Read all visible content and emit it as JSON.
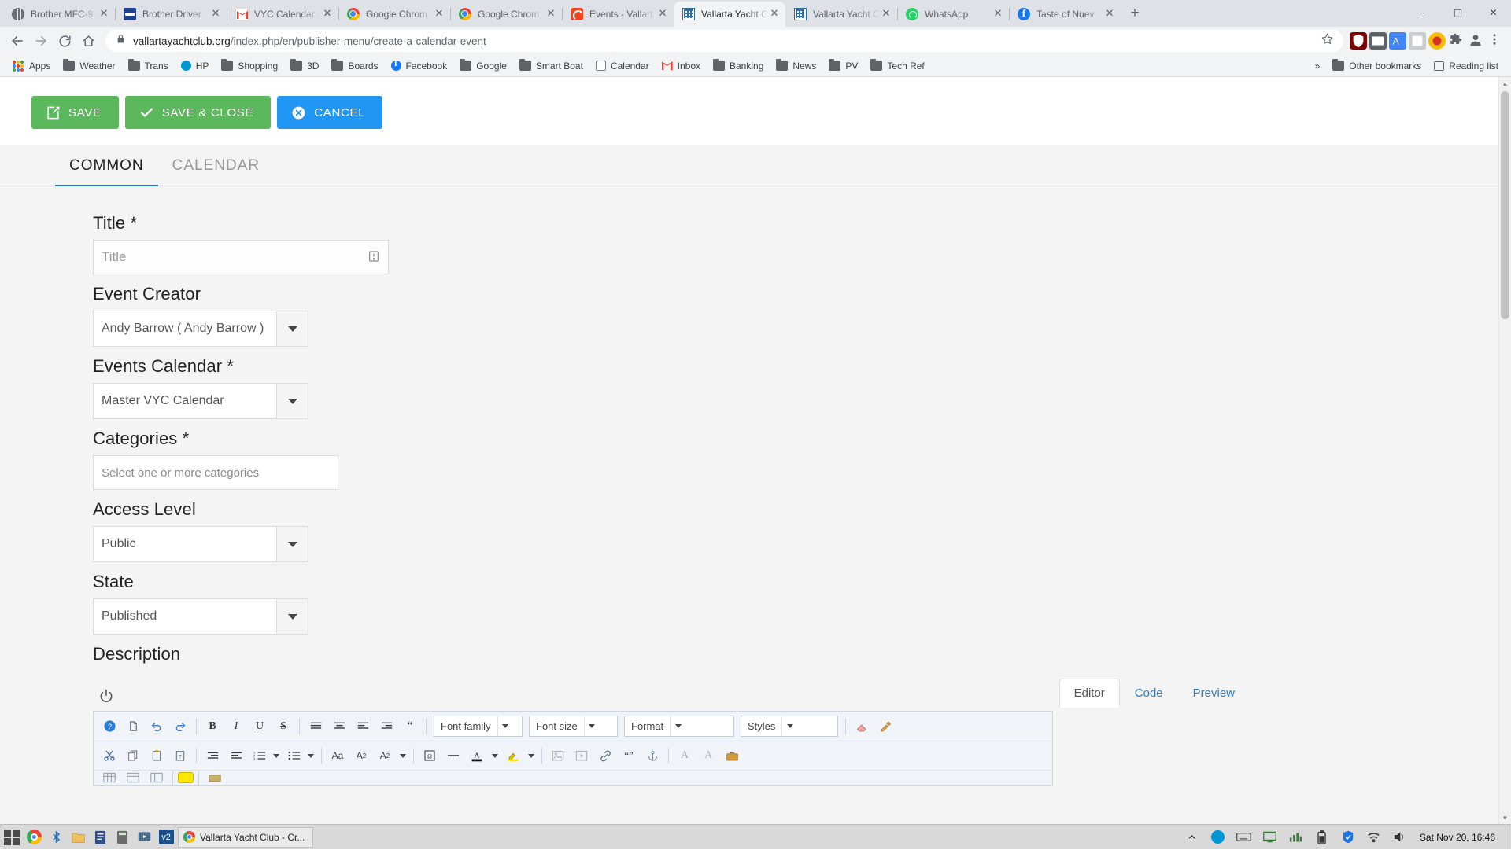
{
  "browser": {
    "tabs": [
      {
        "title": "Brother MFC-9...",
        "favicon": "globe-icon",
        "active": false
      },
      {
        "title": "Brother Driver",
        "favicon": "brother-icon",
        "active": false
      },
      {
        "title": "VYC Calendar -",
        "favicon": "gmail-icon",
        "active": false
      },
      {
        "title": "Google Chrom",
        "favicon": "chrome-icon",
        "active": false
      },
      {
        "title": "Google Chrom",
        "favicon": "chrome-icon",
        "active": false
      },
      {
        "title": "Events - Vallart",
        "favicon": "joomla-icon",
        "active": false
      },
      {
        "title": "Vallarta Yacht C",
        "favicon": "grid-icon",
        "active": true
      },
      {
        "title": "Vallarta Yacht C",
        "favicon": "grid-icon",
        "active": false
      },
      {
        "title": "WhatsApp",
        "favicon": "whatsapp-icon",
        "active": false
      },
      {
        "title": "Taste of Nuev",
        "favicon": "facebook-icon",
        "active": false
      }
    ],
    "new_tab_label": "+",
    "window_controls": [
      "–",
      "□",
      "✕"
    ],
    "omnibox": {
      "url_domain": "vallartayachtclub.org",
      "url_path": "/index.php/en/publisher-menu/create-a-calendar-event",
      "lock_icon": "lock-icon",
      "star_icon": "bookmark-star-icon"
    },
    "bookmarks": [
      {
        "label": "Apps",
        "icon": "apps-grid-icon"
      },
      {
        "label": "Weather",
        "icon": "folder-icon"
      },
      {
        "label": "Trans",
        "icon": "folder-icon"
      },
      {
        "label": "HP",
        "icon": "hp-icon"
      },
      {
        "label": "Shopping",
        "icon": "folder-icon"
      },
      {
        "label": "3D",
        "icon": "folder-icon"
      },
      {
        "label": "Boards",
        "icon": "folder-icon"
      },
      {
        "label": "Facebook",
        "icon": "facebook-icon"
      },
      {
        "label": "Google",
        "icon": "folder-icon"
      },
      {
        "label": "Smart Boat",
        "icon": "folder-icon"
      },
      {
        "label": "Calendar",
        "icon": "calendar-icon"
      },
      {
        "label": "Inbox",
        "icon": "gmail-icon"
      },
      {
        "label": "Banking",
        "icon": "folder-icon"
      },
      {
        "label": "News",
        "icon": "folder-icon"
      },
      {
        "label": "PV",
        "icon": "folder-icon"
      },
      {
        "label": "Tech Ref",
        "icon": "folder-icon"
      }
    ],
    "bookmarks_overflow": "»",
    "other_bookmarks": "Other bookmarks",
    "reading_list": "Reading list"
  },
  "page": {
    "toolbar": [
      {
        "label": "SAVE",
        "icon": "save-pencil-icon",
        "style": "green"
      },
      {
        "label": "SAVE & CLOSE",
        "icon": "check-icon",
        "style": "green"
      },
      {
        "label": "CANCEL",
        "icon": "circle-x-icon",
        "style": "blue"
      }
    ],
    "tabs": [
      {
        "label": "COMMON",
        "active": true
      },
      {
        "label": "CALENDAR",
        "active": false
      }
    ],
    "fields": {
      "title": {
        "label": "Title *",
        "placeholder": "Title",
        "value": "",
        "icon": "calendar-input-icon"
      },
      "event_creator": {
        "label": "Event Creator",
        "value": "Andy Barrow ( Andy Barrow )"
      },
      "events_calendar": {
        "label": "Events Calendar *",
        "value": "Master VYC Calendar"
      },
      "categories": {
        "label": "Categories *",
        "placeholder": "Select one or more categories",
        "value": ""
      },
      "access_level": {
        "label": "Access Level",
        "value": "Public"
      },
      "state": {
        "label": "State",
        "value": "Published"
      },
      "description": {
        "label": "Description"
      }
    },
    "editor": {
      "toggle_icon": "power-toggle-icon",
      "tabs": [
        {
          "label": "Editor",
          "active": true
        },
        {
          "label": "Code",
          "active": false
        },
        {
          "label": "Preview",
          "active": false
        }
      ],
      "toolbar_row1": [
        {
          "icon": "help-icon",
          "glyph": "?"
        },
        {
          "icon": "new-document-icon",
          "glyph": "❐"
        },
        {
          "icon": "undo-icon",
          "glyph": "↶"
        },
        {
          "icon": "redo-icon",
          "glyph": "↷"
        },
        {
          "icon": "bold-icon",
          "glyph": "B"
        },
        {
          "icon": "italic-icon",
          "glyph": "I"
        },
        {
          "icon": "underline-icon",
          "glyph": "U"
        },
        {
          "icon": "strikethrough-icon",
          "glyph": "S"
        },
        {
          "icon": "align-justify-icon",
          "glyph": "≡"
        },
        {
          "icon": "align-center-icon",
          "glyph": "≡"
        },
        {
          "icon": "align-left-icon",
          "glyph": "≡"
        },
        {
          "icon": "align-right-icon",
          "glyph": "≡"
        },
        {
          "icon": "blockquote-icon",
          "glyph": "“"
        }
      ],
      "selects": [
        {
          "name": "font-family-select",
          "value": "Font family"
        },
        {
          "name": "font-size-select",
          "value": "Font size"
        },
        {
          "name": "format-select",
          "value": "Format"
        },
        {
          "name": "styles-select",
          "value": "Styles"
        }
      ],
      "row1_tail": [
        {
          "icon": "eraser-icon",
          "glyph": "◢"
        },
        {
          "icon": "paintbrush-icon",
          "glyph": "✎"
        }
      ],
      "toolbar_row2": [
        {
          "icon": "cut-icon",
          "glyph": "✂"
        },
        {
          "icon": "copy-icon",
          "glyph": "❐"
        },
        {
          "icon": "paste-icon",
          "glyph": "❐"
        },
        {
          "icon": "paste-text-icon",
          "glyph": "❐"
        },
        {
          "icon": "indent-decrease-icon",
          "glyph": "≡"
        },
        {
          "icon": "indent-increase-icon",
          "glyph": "≡"
        },
        {
          "icon": "numbered-list-icon",
          "glyph": "≣"
        },
        {
          "icon": "bullet-list-icon",
          "glyph": "≣"
        },
        {
          "icon": "text-case-icon",
          "glyph": "Aa"
        },
        {
          "icon": "superscript-icon",
          "glyph": "A²"
        },
        {
          "icon": "subscript-icon",
          "glyph": "A₂"
        },
        {
          "icon": "special-character-icon",
          "glyph": "Ω"
        },
        {
          "icon": "horizontal-rule-icon",
          "glyph": "—"
        },
        {
          "icon": "text-color-icon",
          "glyph": "A"
        },
        {
          "icon": "highlight-color-icon",
          "glyph": "✎"
        },
        {
          "icon": "insert-image-icon",
          "glyph": "⛰"
        },
        {
          "icon": "insert-media-icon",
          "glyph": "▶"
        },
        {
          "icon": "insert-link-icon",
          "glyph": "⚭"
        },
        {
          "icon": "quote-icon",
          "glyph": "“”"
        },
        {
          "icon": "anchor-icon",
          "glyph": "⚓"
        },
        {
          "icon": "unlink-icon",
          "glyph": "A"
        },
        {
          "icon": "remove-format-icon",
          "glyph": "A"
        },
        {
          "icon": "toolbox-icon",
          "glyph": "☰"
        }
      ]
    },
    "scrollbar": {
      "name": "page-scrollbar"
    }
  },
  "taskbar": {
    "start_icon": "windows-start-icon",
    "quick_icons": [
      "chrome-icon",
      "bluetooth-icon",
      "folder-icon",
      "notepad-icon",
      "calculator-icon",
      "media-icon",
      "vyc-icon"
    ],
    "active_task": {
      "label": "Vallarta Yacht Club - Cr...",
      "icon": "chrome-icon"
    },
    "tray_icons": [
      "hp-icon",
      "keyboard-icon",
      "display-icon",
      "chart-icon",
      "battery-icon",
      "shield-icon",
      "wifi-icon",
      "volume-icon"
    ],
    "clock": "Sat Nov 20, 16:46",
    "show_desktop": "show-desktop-button"
  }
}
